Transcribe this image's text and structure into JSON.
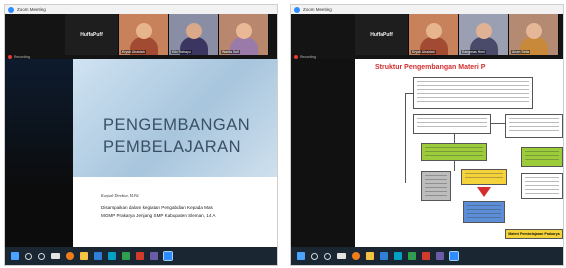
{
  "left": {
    "window_title": "Zoom Meeting",
    "participant_name": "HuffaPuff",
    "video_tiles": [
      {
        "name": "Krysti Ubaidah",
        "bg": "#c8825b",
        "skin": "#e7b58d",
        "cloth": "#a34a32"
      },
      {
        "name": "Kiki Rahayu",
        "bg": "#8a8ea5",
        "skin": "#d9a98a",
        "cloth": "#3b3561"
      },
      {
        "name": "Warita Sufi",
        "bg": "#b9876e",
        "skin": "#e8b897",
        "cloth": "#9a7aa8"
      }
    ],
    "recording_label": "Recording",
    "slide": {
      "title_line1": "PENGEMBANGAN",
      "title_line2": "PEMBELAJARAN",
      "author": "Kurjadi Direktur, M.Pd.",
      "line1": "Disampaikan dalam kegiatan Pengabdian Kepada Mas",
      "line2": "MGMP Prakarya Jenjang SMP Kabupaten Sleman, 14 A"
    }
  },
  "right": {
    "window_title": "Zoom Meeting",
    "participant_name": "HuffaPuff",
    "video_tiles": [
      {
        "name": "Krysti Ubaidah",
        "bg": "#c8825b",
        "skin": "#e7b58d",
        "cloth": "#a34a32"
      },
      {
        "name": "Kangmas Heni",
        "bg": "#9aa0b2",
        "skin": "#dfb296",
        "cloth": "#4a4a6a"
      },
      {
        "name": "Arum Setia",
        "bg": "#b58a72",
        "skin": "#e6b796",
        "cloth": "#c88a3a"
      }
    ],
    "recording_label": "Recording",
    "slide": {
      "title": "Struktur Pengembangan Materi P",
      "bottom_box": "Materi Pembelajaran Prakarya"
    }
  },
  "taskbar_icons": [
    "win",
    "search",
    "circle",
    "wide",
    "orange",
    "yellow",
    "blue",
    "teal",
    "green",
    "red",
    "purple",
    "zoom"
  ],
  "colors": {
    "slide_title": "#3a4f63",
    "right_title": "#d32f2f",
    "flow_green": "#9ccc3a",
    "flow_yellow": "#f4d23a",
    "flow_red": "#d32f2f",
    "flow_blue": "#5b8ed6"
  }
}
